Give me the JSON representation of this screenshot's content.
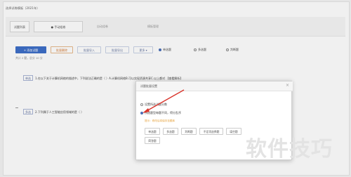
{
  "page": {
    "title": "选择试卷模板（2021年）"
  },
  "tabs": [
    {
      "label": "试题列表"
    },
    {
      "label": "● 手动组卷"
    },
    {
      "label": "自动组卷"
    },
    {
      "label": "模板管理"
    }
  ],
  "toolbar": {
    "buttons": [
      {
        "label": "+ 添加试题"
      },
      {
        "label": "批量删除"
      },
      {
        "label": "批量导入"
      },
      {
        "label": "批量导出"
      },
      {
        "label": "更多 ▾"
      }
    ],
    "radios": [
      {
        "label": "单选题",
        "checked": true
      },
      {
        "label": "多选题",
        "checked": false
      },
      {
        "label": "判断题",
        "checked": false
      }
    ],
    "count_text": "共计 2 题，总分 10 分"
  },
  "questions": [
    {
      "tag": "单选",
      "text": "1.在以下关于计算机网络的描述中，下列说法正确的是（ ）A.计算机网络B.可以实现资源共享C.以上都对 【查看解析】"
    },
    {
      "tag": "多选",
      "text": "2.下列属于人工智能应用领域的是（ ）"
    }
  ],
  "dialog": {
    "title": "试题批量设置",
    "close": "×",
    "options": [
      {
        "label": "设置所选试题分数",
        "checked": false
      },
      {
        "label": "所选题型每题不同，得分乱序",
        "checked": true
      }
    ],
    "hint": "提示：修改后将保存至题库",
    "buttons": [
      {
        "label": "单选题"
      },
      {
        "label": "多选题"
      },
      {
        "label": "判断题"
      },
      {
        "label": "不定项选择题"
      },
      {
        "label": "填空题"
      },
      {
        "label": "简答题"
      }
    ]
  },
  "watermark": "软件技巧",
  "colors": {
    "primary": "#3e6fc8",
    "warn": "#d9803c",
    "arrow": "#d9342b",
    "hint": "#e6a23c"
  }
}
